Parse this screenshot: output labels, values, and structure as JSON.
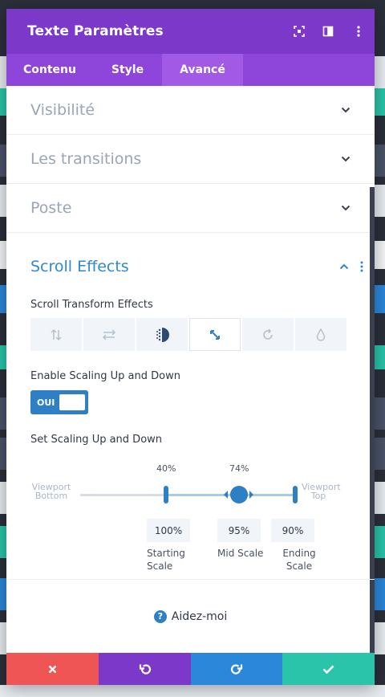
{
  "header": {
    "title": "Texte Paramètres"
  },
  "tabs": [
    {
      "label": "Contenu"
    },
    {
      "label": "Style"
    },
    {
      "label": "Avancé"
    }
  ],
  "sections": [
    {
      "label": "Visibilité"
    },
    {
      "label": "Les transitions"
    },
    {
      "label": "Poste"
    }
  ],
  "scroll_effects": {
    "title": "Scroll Effects",
    "transform_label": "Scroll Transform Effects",
    "effects": [
      "vertical-motion-icon",
      "horizontal-motion-icon",
      "fading-icon",
      "scaling-icon",
      "rotating-icon",
      "blur-icon"
    ],
    "active_effect": 3,
    "enable_label": "Enable Scaling Up and Down",
    "toggle_value": "OUI",
    "set_label": "Set Scaling Up and Down",
    "viewport_bottom": "Viewport Bottom",
    "viewport_top": "Viewport Top",
    "start_pct": "40%",
    "mid_pct": "74%",
    "starting_value": "100%",
    "mid_value": "95%",
    "ending_value": "90%",
    "starting_label": "Starting Scale",
    "mid_label": "Mid Scale",
    "ending_label": "Ending Scale"
  },
  "help": {
    "label": "Aidez-moi"
  },
  "colors": {
    "header": "#7b38c9",
    "accent": "#2e7fc4",
    "cancel": "#ef5555",
    "undo": "#7b38c9",
    "redo": "#2b87da",
    "save": "#29c4a9"
  }
}
